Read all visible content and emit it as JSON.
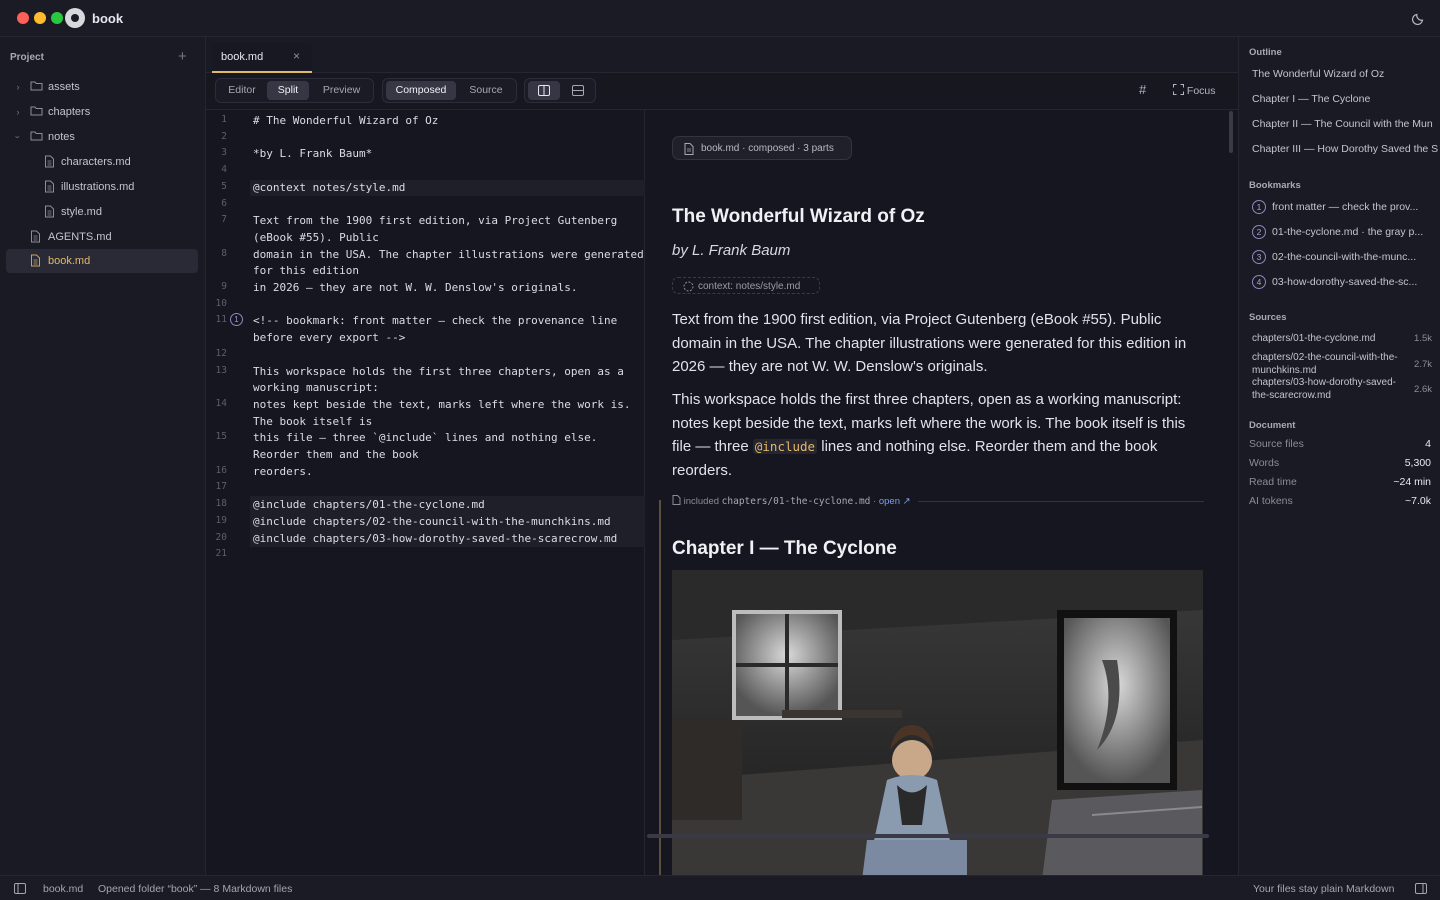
{
  "app": {
    "name": "book"
  },
  "colors": {
    "accent": "#e2b86b",
    "background": "#181822",
    "bookmark": "#8a8ac0",
    "mac_red": "#fe5f57",
    "mac_yellow": "#febc2e",
    "mac_green": "#28c840"
  },
  "sidebar": {
    "header": "Project",
    "add_icon": "+",
    "items": [
      {
        "label": "assets",
        "type": "folder",
        "expanded": false
      },
      {
        "label": "chapters",
        "type": "folder",
        "expanded": false
      },
      {
        "label": "notes",
        "type": "folder",
        "expanded": true
      },
      {
        "label": "characters.md",
        "type": "file"
      },
      {
        "label": "illustrations.md",
        "type": "file"
      },
      {
        "label": "style.md",
        "type": "file"
      },
      {
        "label": "AGENTS.md",
        "type": "file"
      },
      {
        "label": "book.md",
        "type": "file",
        "active": true
      }
    ]
  },
  "tabs": [
    {
      "label": "book.md",
      "close": "×"
    }
  ],
  "toolbar": {
    "view_modes": [
      "Editor",
      "Split",
      "Preview"
    ],
    "active_view": "Split",
    "render_modes": [
      "Composed",
      "Source"
    ],
    "active_render": "Composed",
    "hash_icon": "#",
    "focus_label": "Focus"
  },
  "editor": {
    "lines": [
      {
        "n": "1",
        "text": "# The Wonderful Wizard of Oz"
      },
      {
        "n": "2",
        "text": ""
      },
      {
        "n": "3",
        "text": "*by L. Frank Baum*"
      },
      {
        "n": "4",
        "text": ""
      },
      {
        "n": "5",
        "text": "@context notes/style.md"
      },
      {
        "n": "6",
        "text": ""
      },
      {
        "n": "7",
        "text": "Text from the 1900 first edition, via Project Gutenberg\n(eBook #55). Public"
      },
      {
        "n": "8",
        "text": "domain in the USA. The chapter illustrations were generated\nfor this edition"
      },
      {
        "n": "9",
        "text": "in 2026 — they are not W. W. Denslow's originals."
      },
      {
        "n": "10",
        "text": ""
      },
      {
        "n": "11",
        "text": "<!-- bookmark: front matter — check the provenance line\nbefore every export -->"
      },
      {
        "n": "12",
        "text": ""
      },
      {
        "n": "13",
        "text": "This workspace holds the first three chapters, open as a\nworking manuscript:"
      },
      {
        "n": "14",
        "text": "notes kept beside the text, marks left where the work is.\nThe book itself is"
      },
      {
        "n": "15",
        "text": "this file — three `@include` lines and nothing else.\nReorder them and the book"
      },
      {
        "n": "16",
        "text": "reorders."
      },
      {
        "n": "17",
        "text": ""
      },
      {
        "n": "18",
        "text": "@include chapters/01-the-cyclone.md"
      },
      {
        "n": "19",
        "text": "@include chapters/02-the-council-with-the-munchkins.md"
      },
      {
        "n": "20",
        "text": "@include chapters/03-how-dorothy-saved-the-scarecrow.md"
      },
      {
        "n": "21",
        "text": ""
      }
    ],
    "bookmark_badge": "1"
  },
  "preview": {
    "pill": "book.md · composed · 3 parts",
    "title": "The Wonderful Wizard of Oz",
    "author": "by L. Frank Baum",
    "context_chip": "context: notes/style.md",
    "para1": "Text from the 1900 first edition, via Project Gutenberg (eBook #55). Public domain in the USA. The chapter illustrations were generated for this edition in 2026 — they are not W. W. Denslow's originals.",
    "para2_a": "This workspace holds the first three chapters, open as a working manuscript: notes kept beside the text, marks left where the work is. The book itself is this file — three ",
    "para2_code": "@include",
    "para2_b": " lines and nothing else. Reorder them and the book reorders.",
    "included_prefix": "included",
    "included_file": "chapters/01-the-cyclone.md",
    "included_open": "open ↗",
    "chapter_title": "Chapter I — The Cyclone"
  },
  "outline": {
    "header": "Outline",
    "items": [
      "The Wonderful Wizard of Oz",
      "Chapter I — The Cyclone",
      "Chapter II — The Council with the Mun",
      "Chapter III — How Dorothy Saved the S"
    ]
  },
  "bookmarks": {
    "header": "Bookmarks",
    "items": [
      {
        "n": "1",
        "text": "front matter — check the prov..."
      },
      {
        "n": "2",
        "text": "01-the-cyclone.md · the gray p..."
      },
      {
        "n": "3",
        "text": "02-the-council-with-the-munc..."
      },
      {
        "n": "4",
        "text": "03-how-dorothy-saved-the-sc..."
      }
    ]
  },
  "sources": {
    "header": "Sources",
    "items": [
      {
        "name": "chapters/01-the-cyclone.md",
        "size": "1.5k"
      },
      {
        "name": "chapters/02-the-council-with-the-munchkins.md",
        "size": "2.7k"
      },
      {
        "name": "chapters/03-how-dorothy-saved-the-scarecrow.md",
        "size": "2.6k"
      }
    ]
  },
  "document": {
    "header": "Document",
    "rows": [
      {
        "key": "Source files",
        "value": "4"
      },
      {
        "key": "Words",
        "value": "5,300"
      },
      {
        "key": "Read time",
        "value": "~24 min"
      },
      {
        "key": "AI tokens",
        "value": "~7.0k"
      }
    ]
  },
  "status": {
    "file": "book.md",
    "message": "Opened folder “book” — 8 Markdown files",
    "right": "Your files stay plain Markdown"
  }
}
